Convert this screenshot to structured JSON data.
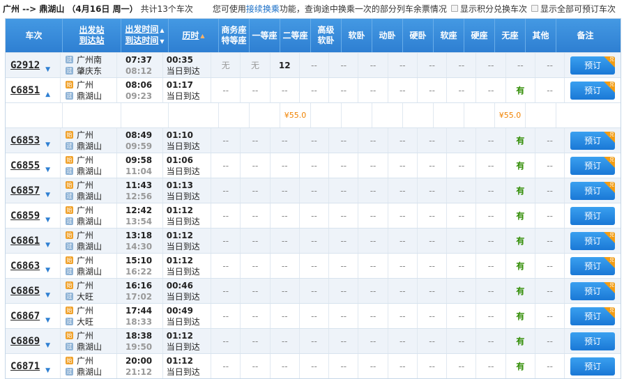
{
  "header": {
    "route": "广州 --> 鼎湖山",
    "date": "（4月16日 周一）",
    "count": "共计13个车次",
    "notice_pre": "您可使用",
    "notice_link": "接续换乘",
    "notice_post": "功能，查询途中换乘一次的部分列车余票情况",
    "opt_points": "显示积分兑换车次",
    "opt_all": "显示全部可预订车次"
  },
  "columns": {
    "train": "车次",
    "station_from": "出发站",
    "station_to": "到达站",
    "time_dep": "出发时间",
    "time_arr": "到达时间",
    "duration": "历时",
    "business_1": "商务座",
    "business_2": "特等座",
    "first": "一等座",
    "second": "二等座",
    "soft_sleeper_hi_1": "高级",
    "soft_sleeper_hi_2": "软卧",
    "soft_sleeper": "软卧",
    "moving_sleeper": "动卧",
    "hard_sleeper": "硬卧",
    "soft_seat": "软座",
    "hard_seat": "硬座",
    "no_seat": "无座",
    "other": "其他",
    "note": "备注"
  },
  "book_label": "预订",
  "badge_label": "兑",
  "station_icons": {
    "start": "始",
    "through": "过",
    "end": "终"
  },
  "day_label": "当日到达",
  "dash": "--",
  "price_row": {
    "second": "¥55.0",
    "no_seat": "¥55.0"
  },
  "trains": [
    {
      "no": "G2912",
      "arrow": "▼",
      "from": "广州南",
      "from_type": "through",
      "to": "肇庆东",
      "to_type": "through",
      "dep": "07:37",
      "arr": "08:12",
      "dur": "00:35",
      "seats": [
        "无",
        "无",
        "12",
        "--",
        "--",
        "--",
        "--",
        "--",
        "--",
        "--",
        "--",
        "--"
      ],
      "badge": true
    },
    {
      "no": "C6851",
      "arrow": "▲",
      "from": "广州",
      "from_type": "start",
      "to": "鼎湖山",
      "to_type": "through",
      "dep": "08:06",
      "arr": "09:23",
      "dur": "01:17",
      "seats": [
        "--",
        "--",
        "--",
        "--",
        "--",
        "--",
        "--",
        "--",
        "--",
        "--",
        "有",
        "--"
      ],
      "badge": true
    },
    {
      "no": "C6853",
      "arrow": "▼",
      "from": "广州",
      "from_type": "start",
      "to": "鼎湖山",
      "to_type": "through",
      "dep": "08:49",
      "arr": "09:59",
      "dur": "01:10",
      "seats": [
        "--",
        "--",
        "--",
        "--",
        "--",
        "--",
        "--",
        "--",
        "--",
        "--",
        "有",
        "--"
      ],
      "badge": true
    },
    {
      "no": "C6855",
      "arrow": "▼",
      "from": "广州",
      "from_type": "start",
      "to": "鼎湖山",
      "to_type": "through",
      "dep": "09:58",
      "arr": "11:04",
      "dur": "01:06",
      "seats": [
        "--",
        "--",
        "--",
        "--",
        "--",
        "--",
        "--",
        "--",
        "--",
        "--",
        "有",
        "--"
      ],
      "badge": true
    },
    {
      "no": "C6857",
      "arrow": "▼",
      "from": "广州",
      "from_type": "start",
      "to": "鼎湖山",
      "to_type": "through",
      "dep": "11:43",
      "arr": "12:56",
      "dur": "01:13",
      "seats": [
        "--",
        "--",
        "--",
        "--",
        "--",
        "--",
        "--",
        "--",
        "--",
        "--",
        "有",
        "--"
      ],
      "badge": true
    },
    {
      "no": "C6859",
      "arrow": "▼",
      "from": "广州",
      "from_type": "start",
      "to": "鼎湖山",
      "to_type": "through",
      "dep": "12:42",
      "arr": "13:54",
      "dur": "01:12",
      "seats": [
        "--",
        "--",
        "--",
        "--",
        "--",
        "--",
        "--",
        "--",
        "--",
        "--",
        "有",
        "--"
      ],
      "badge": false
    },
    {
      "no": "C6861",
      "arrow": "▼",
      "from": "广州",
      "from_type": "start",
      "to": "鼎湖山",
      "to_type": "through",
      "dep": "13:18",
      "arr": "14:30",
      "dur": "01:12",
      "seats": [
        "--",
        "--",
        "--",
        "--",
        "--",
        "--",
        "--",
        "--",
        "--",
        "--",
        "有",
        "--"
      ],
      "badge": true
    },
    {
      "no": "C6863",
      "arrow": "▼",
      "from": "广州",
      "from_type": "start",
      "to": "鼎湖山",
      "to_type": "through",
      "dep": "15:10",
      "arr": "16:22",
      "dur": "01:12",
      "seats": [
        "--",
        "--",
        "--",
        "--",
        "--",
        "--",
        "--",
        "--",
        "--",
        "--",
        "有",
        "--"
      ],
      "badge": true
    },
    {
      "no": "C6865",
      "arrow": "▼",
      "from": "广州",
      "from_type": "start",
      "to": "大旺",
      "to_type": "through",
      "dep": "16:16",
      "arr": "17:02",
      "dur": "00:46",
      "seats": [
        "--",
        "--",
        "--",
        "--",
        "--",
        "--",
        "--",
        "--",
        "--",
        "--",
        "有",
        "--"
      ],
      "badge": true
    },
    {
      "no": "C6867",
      "arrow": "▼",
      "from": "广州",
      "from_type": "start",
      "to": "大旺",
      "to_type": "through",
      "dep": "17:44",
      "arr": "18:33",
      "dur": "00:49",
      "seats": [
        "--",
        "--",
        "--",
        "--",
        "--",
        "--",
        "--",
        "--",
        "--",
        "--",
        "有",
        "--"
      ],
      "badge": true
    },
    {
      "no": "C6869",
      "arrow": "▼",
      "from": "广州",
      "from_type": "start",
      "to": "鼎湖山",
      "to_type": "through",
      "dep": "18:38",
      "arr": "19:50",
      "dur": "01:12",
      "seats": [
        "--",
        "--",
        "--",
        "--",
        "--",
        "--",
        "--",
        "--",
        "--",
        "--",
        "有",
        "--"
      ],
      "badge": false
    },
    {
      "no": "C6871",
      "arrow": "▼",
      "from": "广州",
      "from_type": "start",
      "to": "鼎湖山",
      "to_type": "through",
      "dep": "20:00",
      "arr": "21:12",
      "dur": "01:12",
      "seats": [
        "--",
        "--",
        "--",
        "--",
        "--",
        "--",
        "--",
        "--",
        "--",
        "--",
        "有",
        "--"
      ],
      "badge": false
    }
  ]
}
